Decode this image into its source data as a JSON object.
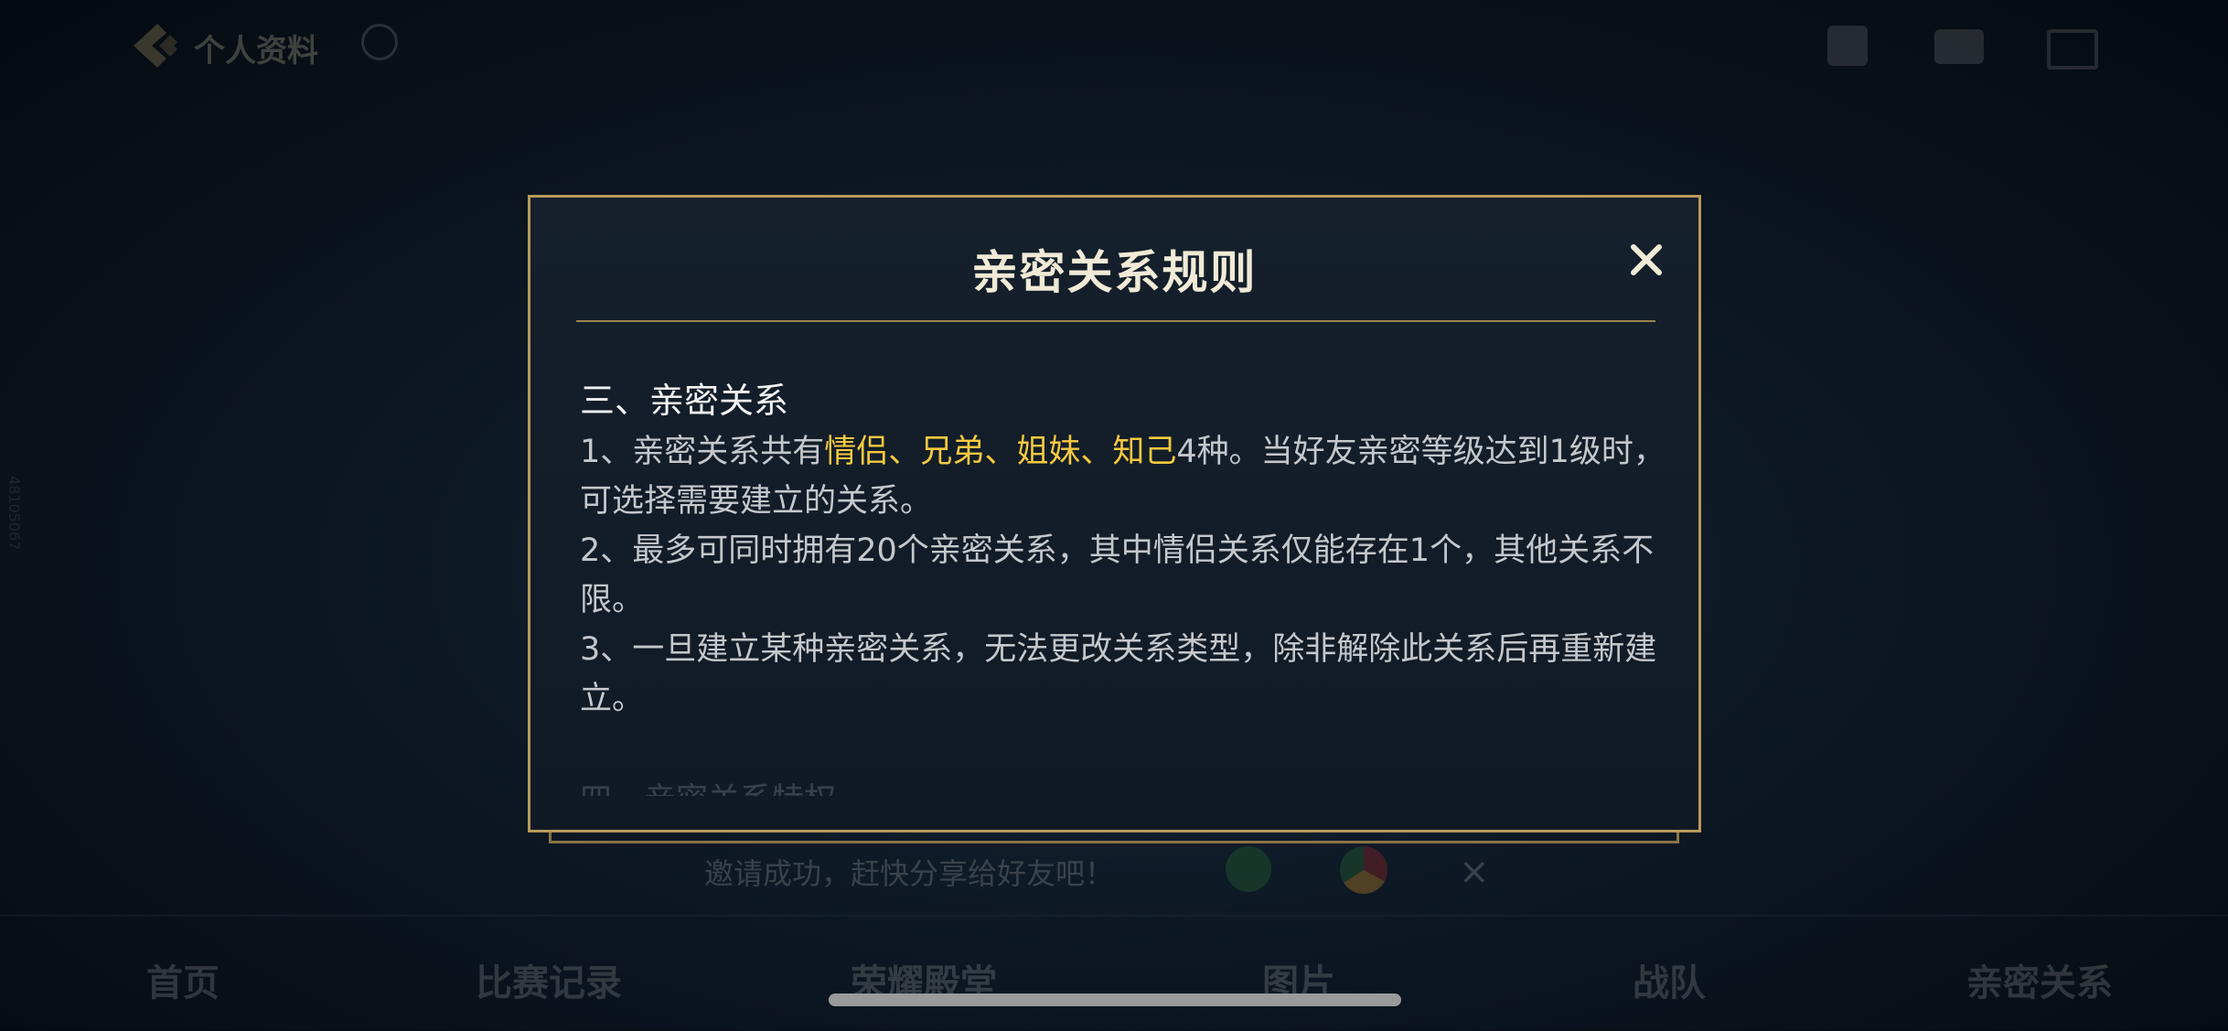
{
  "background": {
    "top_title": "个人资料",
    "bottom_tabs": [
      "首页",
      "比赛记录",
      "荣耀殿堂",
      "图片",
      "战队",
      "亲密关系"
    ],
    "share_text": "邀请成功，赶快分享给好友吧！",
    "side_text": "48105067"
  },
  "dialog": {
    "title": "亲密关系规则",
    "section_heading": "三、亲密关系",
    "rule1": {
      "prefix": "1、亲密关系共有",
      "types": [
        "情侣",
        "兄弟",
        "姐妹",
        "知己"
      ],
      "separator": "、",
      "suffix": "4种。当好友亲密等级达到1级时，可选择需要建立的关系。"
    },
    "rule2": "2、最多可同时拥有20个亲密关系，其中情侣关系仅能存在1个，其他关系不限。",
    "rule3": "3、一旦建立某种亲密关系，无法更改关系类型，除非解除此关系后再重新建立。",
    "next_section_partial": "四、亲密关系特权"
  },
  "colors": {
    "highlight": "#f6c940",
    "border_gold": "#b89a5a",
    "title_text": "#f0ead6"
  },
  "icons": [
    "back-icon",
    "help-icon",
    "close-icon"
  ]
}
